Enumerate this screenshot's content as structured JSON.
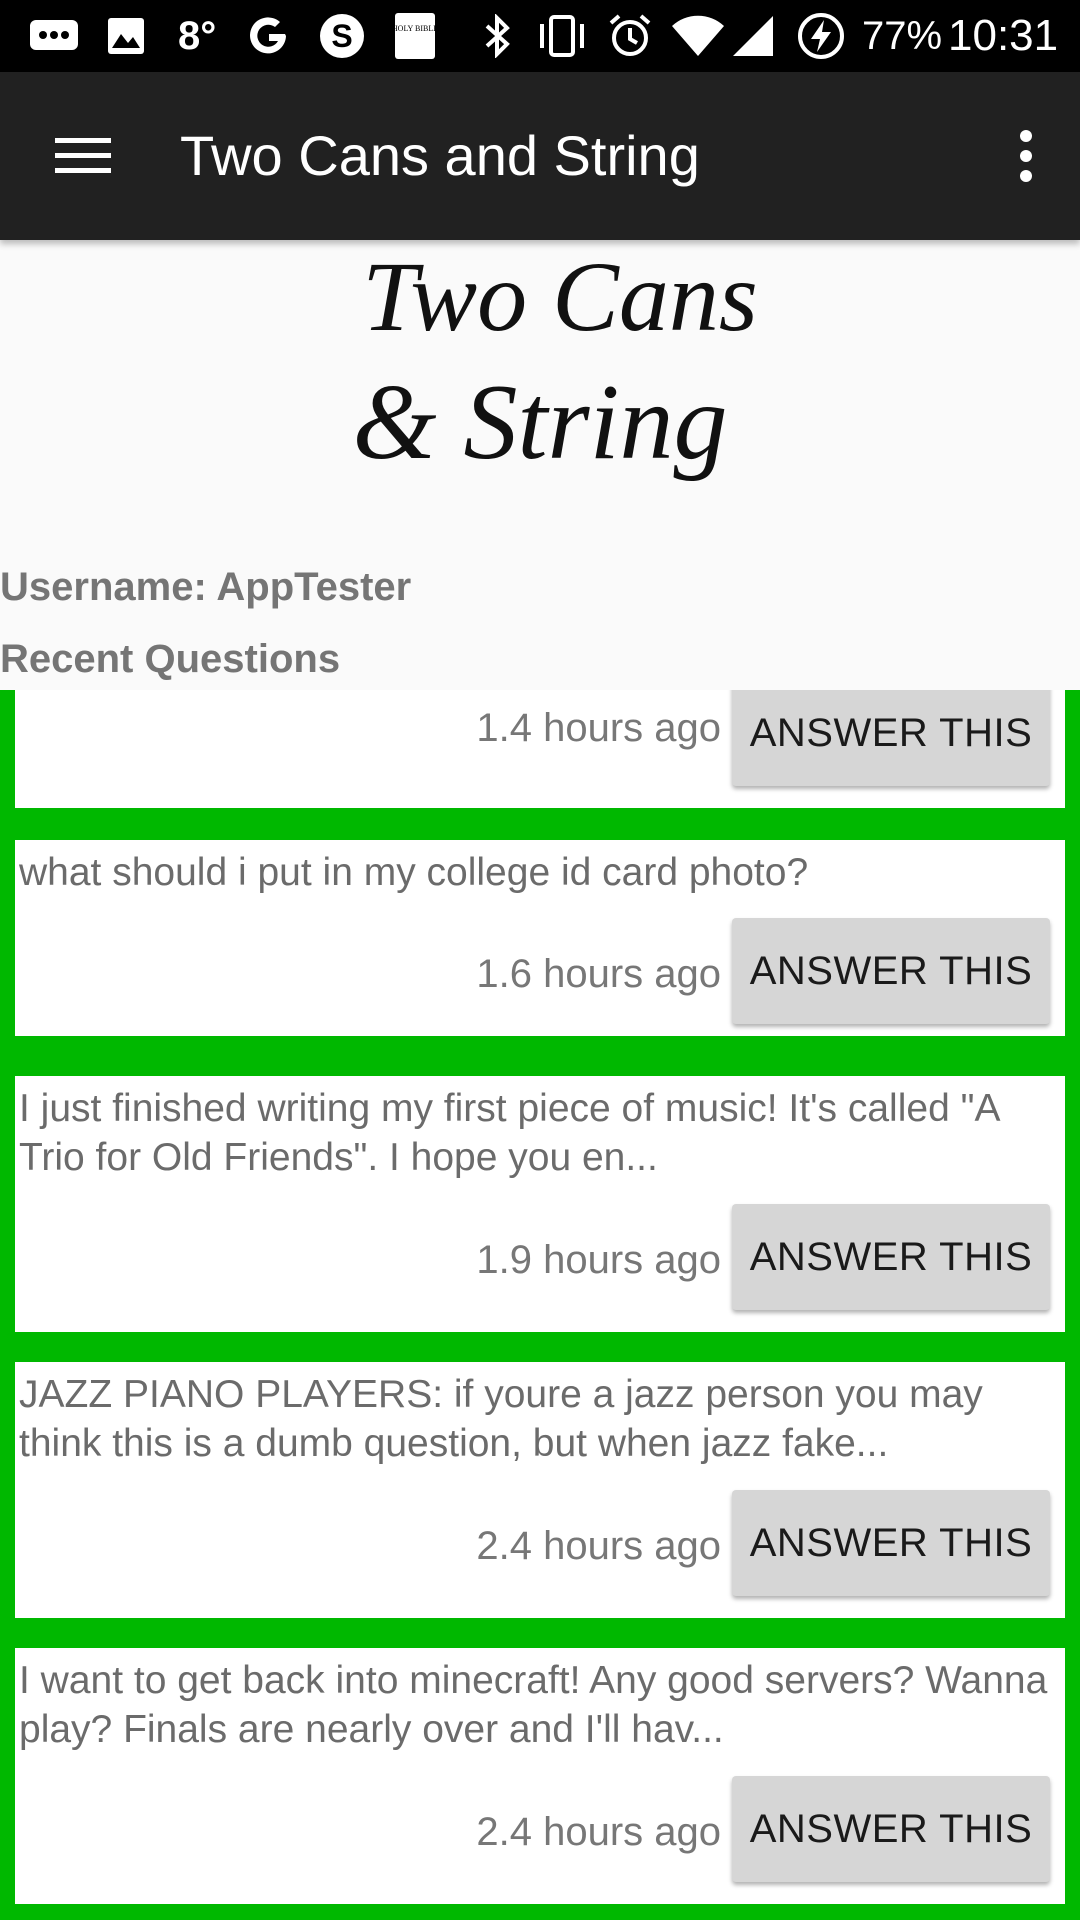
{
  "status_bar": {
    "temperature": "8°",
    "battery_percent": "77%",
    "time": "10:31",
    "icons": [
      "messages-icon",
      "gallery-icon",
      "google-icon",
      "skype-icon",
      "bible-icon",
      "bluetooth-icon",
      "vibrate-icon",
      "alarm-icon",
      "wifi-icon",
      "signal-icon",
      "battery-charging-icon"
    ],
    "bible_icon_text": "HOLY BIBLE"
  },
  "app_bar": {
    "title": "Two Cans and String",
    "menu_icon": "hamburger-menu-icon",
    "overflow_icon": "more-vert-icon"
  },
  "logo": {
    "line1": "Two Cans",
    "line2": "& String"
  },
  "user": {
    "username_label": "Username: AppTester"
  },
  "section": {
    "recent_questions_label": "Recent Questions"
  },
  "questions": [
    {
      "text": "",
      "time": "1.4 hours ago",
      "button": "ANSWER THIS"
    },
    {
      "text": "what should i put in my college id card photo?",
      "time": "1.6 hours ago",
      "button": "ANSWER THIS"
    },
    {
      "text": "I just finished writing my first piece of music! It's called \"A Trio for Old Friends\". I hope you en...",
      "time": "1.9 hours ago",
      "button": "ANSWER THIS"
    },
    {
      "text": "JAZZ PIANO PLAYERS: if youre a jazz person you may think this is a dumb question, but when jazz fake...",
      "time": "2.4 hours ago",
      "button": "ANSWER THIS"
    },
    {
      "text": "I want to get back into minecraft! Any good servers? Wanna play? Finals are nearly over and I'll hav...",
      "time": "2.4 hours ago",
      "button": "ANSWER THIS"
    }
  ],
  "colors": {
    "list_background": "#00b800",
    "app_bar": "#212121",
    "button": "#d6d6d6"
  }
}
